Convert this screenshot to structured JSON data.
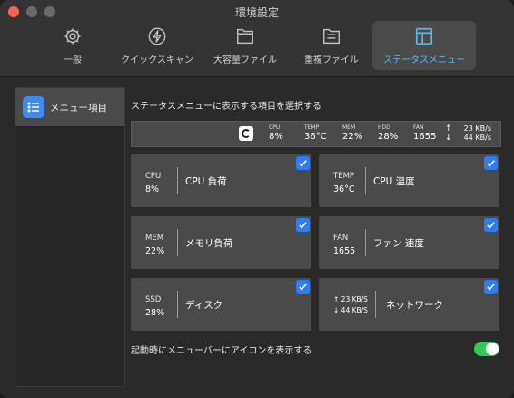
{
  "window": {
    "title": "環境設定"
  },
  "tabs": [
    {
      "label": "一般",
      "icon": "gear-icon"
    },
    {
      "label": "クイックスキャン",
      "icon": "bolt-icon"
    },
    {
      "label": "大容量ファイル",
      "icon": "folder-icon"
    },
    {
      "label": "重複ファイル",
      "icon": "duplicate-folder-icon"
    },
    {
      "label": "ステータスメニュー",
      "icon": "menu-layout-icon",
      "active": true
    }
  ],
  "sidebar": {
    "items": [
      {
        "label": "メニュー項目",
        "icon": "list-icon",
        "selected": true
      }
    ]
  },
  "main": {
    "heading": "ステータスメニューに表示する項目を選択する",
    "preview": {
      "metrics": [
        {
          "label": "CPU",
          "value": "8%"
        },
        {
          "label": "TEMP",
          "value": "36°C"
        },
        {
          "label": "MEM",
          "value": "22%"
        },
        {
          "label": "HDD",
          "value": "28%"
        },
        {
          "label": "FAN",
          "value": "1655"
        }
      ],
      "net_up": "23 KB/s",
      "net_down": "44 KB/s"
    },
    "cards": [
      {
        "small_label": "CPU",
        "small_value": "8%",
        "name": "CPU 負荷",
        "checked": true
      },
      {
        "small_label": "TEMP",
        "small_value": "36°C",
        "name": "CPU 温度",
        "checked": true
      },
      {
        "small_label": "MEM",
        "small_value": "22%",
        "name": "メモリ負荷",
        "checked": true
      },
      {
        "small_label": "FAN",
        "small_value": "1655",
        "name": "ファン 速度",
        "checked": true
      },
      {
        "small_label": "SSD",
        "small_value": "28%",
        "name": "ディスク",
        "checked": true
      },
      {
        "small_label": "↑ 23 KB/S",
        "small_value": "↓ 44 KB/S",
        "name": "ネットワーク",
        "checked": true
      }
    ],
    "footer": {
      "label": "起動時にメニューバーにアイコンを表示する",
      "toggle_on": true
    }
  },
  "colors": {
    "accent": "#2f7df6",
    "active_tab_text": "#5ab8ea",
    "toggle_on": "#34c759",
    "close_button": "#ff5f57"
  }
}
